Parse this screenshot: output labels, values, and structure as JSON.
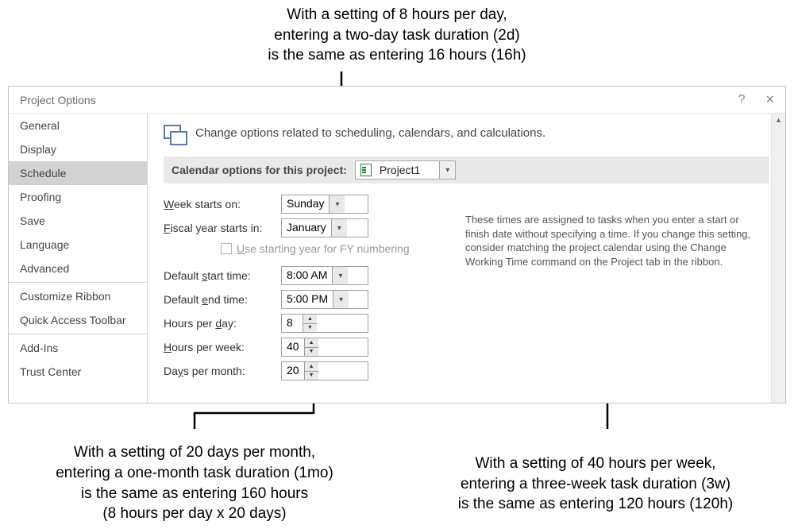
{
  "annotations": {
    "top": "With a setting of 8 hours per day,\nentering a two-day task duration (2d)\nis the same as entering 16 hours (16h)",
    "bottom_left": "With a setting of 20 days per month,\nentering a one-month task duration (1mo)\nis the same as entering 160 hours\n(8 hours per day x 20 days)",
    "bottom_right": "With a setting of 40 hours per week,\nentering a three-week task duration (3w)\nis the same as entering 120 hours (120h)"
  },
  "window": {
    "title": "Project Options",
    "help_glyph": "?",
    "close_glyph": "×"
  },
  "sidebar": {
    "items": [
      "General",
      "Display",
      "Schedule",
      "Proofing",
      "Save",
      "Language",
      "Advanced"
    ],
    "items2": [
      "Customize Ribbon",
      "Quick Access Toolbar"
    ],
    "items3": [
      "Add-Ins",
      "Trust Center"
    ],
    "selected_index": 2
  },
  "main": {
    "heading": "Change options related to scheduling, calendars, and calculations.",
    "section_label": "Calendar options for this project:",
    "project_name": "Project1",
    "week_label_pre": "W",
    "week_label_rest": "eek starts on:",
    "week_value": "Sunday",
    "fiscal_label_pre": "F",
    "fiscal_label_rest": "iscal year starts in:",
    "fiscal_value": "January",
    "fy_checkbox_pre": "U",
    "fy_checkbox_rest": "se starting year for FY numbering",
    "start_label_prefix": "Default ",
    "start_label_u": "s",
    "start_label_rest": "tart time:",
    "start_value": "8:00 AM",
    "end_label_prefix": "Default ",
    "end_label_u": "e",
    "end_label_rest": "nd time:",
    "end_value": "5:00 PM",
    "hpd_label_pre": "Hours per ",
    "hpd_label_u": "d",
    "hpd_label_rest": "ay:",
    "hpd_value": "8",
    "hpw_label_pre": "",
    "hpw_label_u": "H",
    "hpw_label_rest": "ours per week:",
    "hpw_value": "40",
    "dpm_label_pre": "Da",
    "dpm_label_u": "y",
    "dpm_label_rest": "s per month:",
    "dpm_value": "20",
    "tip_text": "These times are assigned to tasks when you enter a start or finish date without specifying a time. If you change this setting, consider matching the project calendar using the Change Working Time command on the Project tab in the ribbon."
  }
}
